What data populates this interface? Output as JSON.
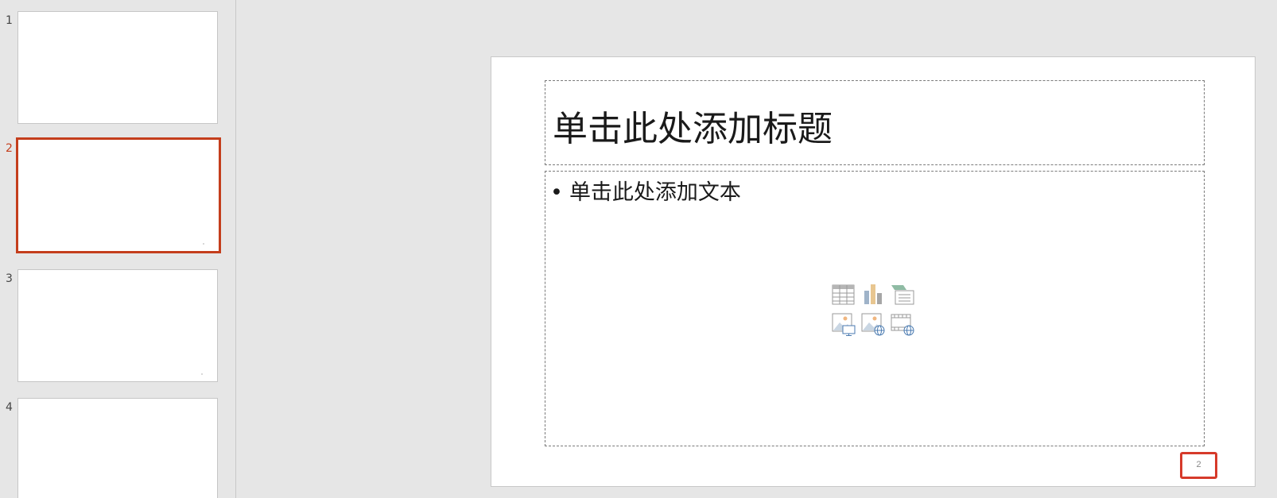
{
  "thumbnails": [
    {
      "number": "1"
    },
    {
      "number": "2",
      "active": true
    },
    {
      "number": "3"
    },
    {
      "number": "4"
    }
  ],
  "slide": {
    "title_placeholder": "单击此处添加标题",
    "bullet": "•",
    "body_placeholder": "单击此处添加文本",
    "slide_number": "2"
  },
  "insert_icons": [
    "table-icon",
    "chart-icon",
    "smartart-icon",
    "picture-icon",
    "online-picture-icon",
    "video-icon"
  ],
  "colors": {
    "accent": "#c43e1c",
    "highlight": "#d63a2a",
    "background": "#e6e6e6",
    "slide": "#ffffff"
  }
}
